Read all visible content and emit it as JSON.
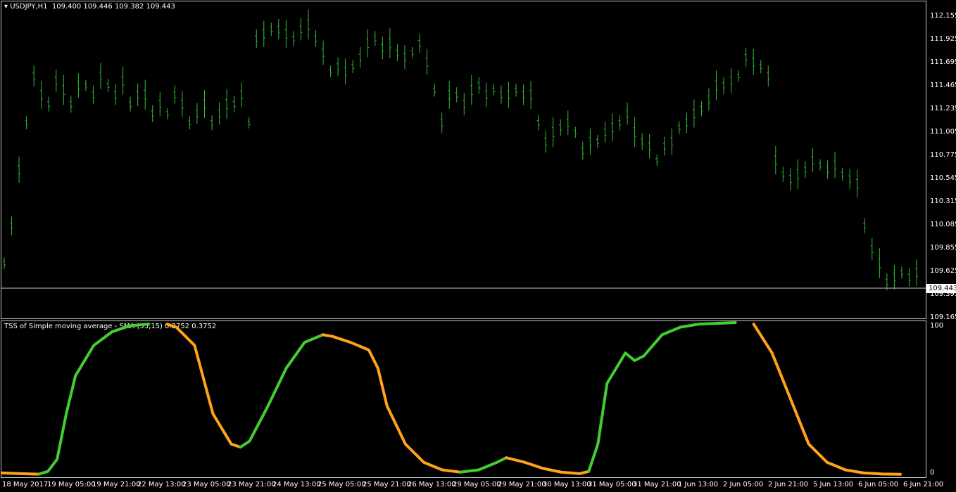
{
  "main_title": {
    "symbol": "USDJPY,H1",
    "ohlc": "109.400 109.446 109.382 109.443"
  },
  "indicator_title": "TSS of Simple moving average - SMA (55,15) 0.3752 0.3752",
  "price_axis": [
    "112.155",
    "111.925",
    "111.695",
    "111.465",
    "111.235",
    "111.005",
    "110.775",
    "110.545",
    "110.315",
    "110.085",
    "109.855",
    "109.625",
    "109.395",
    "109.165"
  ],
  "current_price": "109.443",
  "indicator_axis": [
    "100",
    "0"
  ],
  "time_axis": [
    "18 May 2017",
    "19 May 05:00",
    "19 May 21:00",
    "22 May 13:00",
    "23 May 05:00",
    "23 May 21:00",
    "24 May 13:00",
    "25 May 05:00",
    "25 May 21:00",
    "26 May 13:00",
    "29 May 05:00",
    "29 May 21:00",
    "30 May 13:00",
    "31 May 05:00",
    "31 May 21:00",
    "1 Jun 13:00",
    "2 Jun 05:00",
    "2 Jun 21:00",
    "5 Jun 13:00",
    "6 Jun 05:00",
    "6 Jun 21:00"
  ],
  "colors": {
    "background": "#000000",
    "bars": "#2fbf2f",
    "up": "#44cc33",
    "down": "#ffa31a",
    "grid": "#c8c8c8"
  },
  "chart_data": [
    {
      "type": "line",
      "name": "USDJPY,H1 bars",
      "ylim": [
        109.165,
        112.155
      ],
      "values": [
        109.5,
        109.9,
        110.5,
        111.0,
        111.5,
        111.3,
        111.2,
        111.45,
        111.35,
        111.2,
        111.4,
        111.4,
        111.3,
        111.5,
        111.4,
        111.3,
        111.45,
        111.2,
        111.3,
        111.3,
        111.1,
        111.2,
        111.1,
        111.3,
        111.2,
        111.0,
        111.1,
        111.2,
        111.0,
        111.1,
        111.2,
        111.2,
        111.3,
        111.0,
        111.9,
        111.95,
        112.0,
        112.0,
        111.95,
        111.9,
        112.0,
        112.05,
        111.9,
        111.75,
        111.55,
        111.6,
        111.55,
        111.6,
        111.7,
        111.85,
        111.9,
        111.8,
        111.85,
        111.75,
        111.7,
        111.75,
        111.85,
        111.65,
        111.35,
        111.0,
        111.3,
        111.3,
        111.2,
        111.35,
        111.4,
        111.3,
        111.35,
        111.3,
        111.3,
        111.35,
        111.3,
        111.3,
        111.0,
        110.8,
        110.9,
        110.95,
        111.0,
        110.9,
        110.7,
        110.8,
        110.8,
        110.9,
        110.95,
        111.0,
        111.1,
        110.9,
        110.8,
        110.75,
        110.6,
        110.75,
        110.8,
        110.95,
        111.0,
        111.1,
        111.15,
        111.25,
        111.4,
        111.4,
        111.45,
        111.5,
        111.7,
        111.65,
        111.6,
        111.5,
        110.6,
        110.45,
        110.4,
        110.45,
        110.5,
        110.6,
        110.55,
        110.5,
        110.55,
        110.45,
        110.4,
        110.35,
        109.9,
        109.65,
        109.5,
        109.3,
        109.35,
        109.4,
        109.35,
        109.4
      ]
    },
    {
      "type": "line",
      "name": "TSS of Simple moving average - SMA (55,15)",
      "ylim": [
        0,
        100
      ],
      "x_range": [
        0,
        100
      ],
      "points": [
        [
          0,
          1
        ],
        [
          2,
          0.5
        ],
        [
          4,
          0.2
        ],
        [
          5,
          2
        ],
        [
          6,
          10
        ],
        [
          7,
          40
        ],
        [
          8,
          65
        ],
        [
          10,
          85
        ],
        [
          12,
          94
        ],
        [
          14,
          98
        ],
        [
          16,
          99
        ],
        [
          18,
          99
        ],
        [
          19,
          97
        ],
        [
          21,
          85
        ],
        [
          23,
          40
        ],
        [
          25,
          20
        ],
        [
          26,
          18
        ],
        [
          27,
          22
        ],
        [
          29,
          45
        ],
        [
          31,
          70
        ],
        [
          33,
          87
        ],
        [
          35,
          92
        ],
        [
          36,
          91
        ],
        [
          38,
          87
        ],
        [
          40,
          82
        ],
        [
          41,
          70
        ],
        [
          42,
          45
        ],
        [
          44,
          20
        ],
        [
          46,
          8
        ],
        [
          48,
          3
        ],
        [
          50,
          1.5
        ],
        [
          52,
          3
        ],
        [
          54,
          8
        ],
        [
          55,
          11
        ],
        [
          57,
          8
        ],
        [
          59,
          4
        ],
        [
          61,
          1.5
        ],
        [
          63,
          0.5
        ],
        [
          64,
          2
        ],
        [
          65,
          20
        ],
        [
          66,
          60
        ],
        [
          68,
          80
        ],
        [
          69,
          75
        ],
        [
          70,
          78
        ],
        [
          72,
          92
        ],
        [
          74,
          97
        ],
        [
          76,
          99
        ],
        [
          80,
          100
        ],
        [
          82,
          99
        ],
        [
          84,
          80
        ],
        [
          86,
          50
        ],
        [
          88,
          20
        ],
        [
          90,
          8
        ],
        [
          92,
          3
        ],
        [
          94,
          1
        ],
        [
          96,
          0.3
        ],
        [
          98,
          0.1
        ]
      ],
      "colored_segments": [
        {
          "from": 0,
          "to": 4,
          "color": "down"
        },
        {
          "from": 4,
          "to": 17,
          "color": "up"
        },
        {
          "from": 17,
          "to": 26,
          "color": "down"
        },
        {
          "from": 26,
          "to": 35,
          "color": "up"
        },
        {
          "from": 35,
          "to": 50,
          "color": "down"
        },
        {
          "from": 50,
          "to": 55,
          "color": "up"
        },
        {
          "from": 55,
          "to": 64,
          "color": "down"
        },
        {
          "from": 64,
          "to": 81,
          "color": "up"
        },
        {
          "from": 81,
          "to": 98,
          "color": "down"
        }
      ]
    }
  ]
}
